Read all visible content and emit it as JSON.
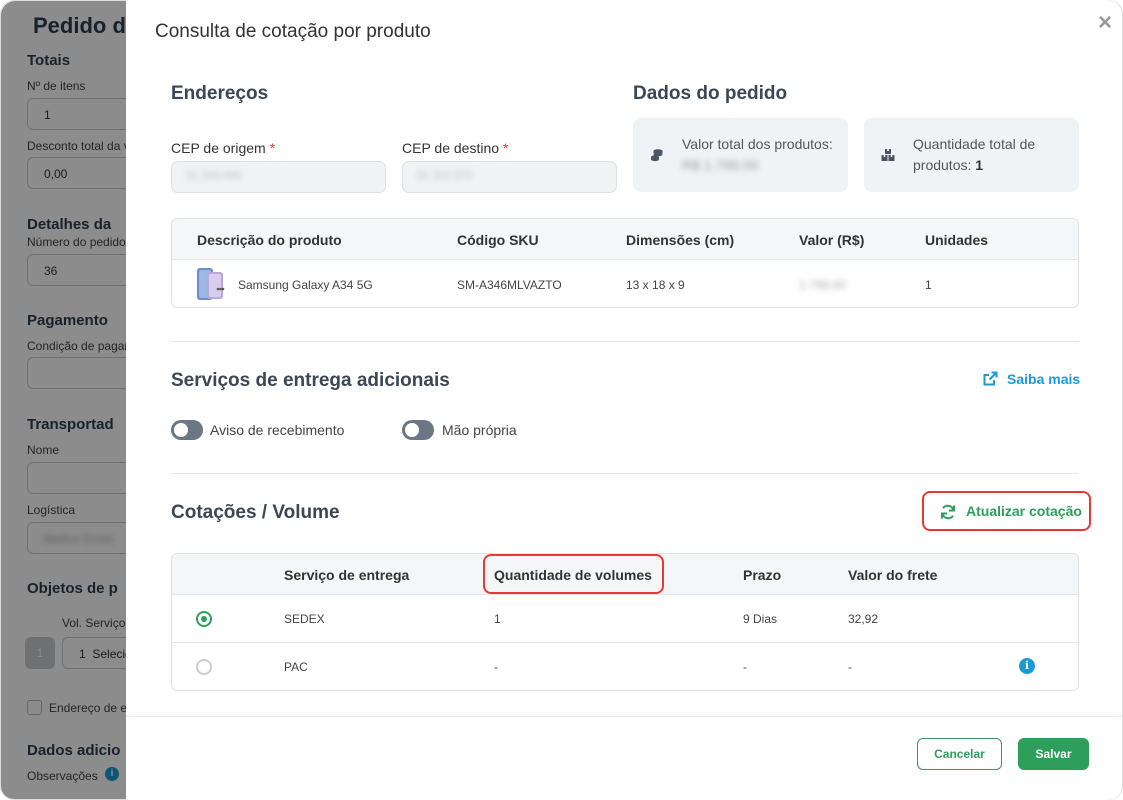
{
  "background": {
    "title": "Pedido d",
    "sections": {
      "totals": "Totais",
      "num_items_label": "Nº de itens",
      "num_items_value": "1",
      "discount_label": "Desconto total da v",
      "discount_value": "0,00",
      "details": "Detalhes da",
      "order_number_label": "Número do pedido",
      "order_number_value": "36",
      "payment": "Pagamento",
      "payment_condition_label": "Condição de pagam",
      "carrier": "Transportad",
      "name_label": "Nome",
      "logistics_label": "Logística",
      "logistics_value": "Melhor Envio",
      "objects": "Objetos de p",
      "vol_service_label": "Vol. Serviço",
      "vol_badge": "1",
      "vol_select_num": "1",
      "vol_select_text": "Selecion",
      "address_checkbox_label": "Endereço de e",
      "additional": "Dados adicio",
      "observations_label": "Observações"
    }
  },
  "modal": {
    "title": "Consulta de cotação por produto",
    "close_icon": "close-icon",
    "addresses": {
      "title": "Endereços",
      "origin_label": "CEP de origem",
      "origin_value": "91 200-000",
      "destination_label": "CEP de destino",
      "destination_value": "91 202-970",
      "required_mark": "*"
    },
    "order_data": {
      "title": "Dados do pedido",
      "total_value_label": "Valor total dos produtos:",
      "total_value": "R$ 1.799,00",
      "total_qty_label": "Quantidade total de produtos:",
      "total_qty": "1"
    },
    "products_table": {
      "headers": [
        "Descrição do produto",
        "Código SKU",
        "Dimensões (cm)",
        "Valor (R$)",
        "Unidades"
      ],
      "rows": [
        {
          "name": "Samsung Galaxy A34 5G",
          "sku": "SM-A346MLVAZTO",
          "dimensions": "13 x 18 x 9",
          "value": "1.799,00",
          "units": "1"
        }
      ]
    },
    "extra_services": {
      "title": "Serviços de entrega adicionais",
      "learn_more": "Saiba mais",
      "toggles": [
        {
          "label": "Aviso de recebimento",
          "on": false
        },
        {
          "label": "Mão própria",
          "on": false
        }
      ]
    },
    "quotes": {
      "title": "Cotações / Volume",
      "refresh_button": "Atualizar cotação",
      "headers": [
        "Serviço de entrega",
        "Quantidade de volumes",
        "Prazo",
        "Valor do frete"
      ],
      "rows": [
        {
          "service": "SEDEX",
          "volumes": "1",
          "deadline": "9 Dias",
          "price": "32,92",
          "selected": true
        },
        {
          "service": "PAC",
          "volumes": "-",
          "deadline": "-",
          "price": "-",
          "selected": false
        }
      ]
    },
    "footer": {
      "cancel": "Cancelar",
      "save": "Salvar"
    }
  },
  "colors": {
    "accent_green": "#2e9e5b",
    "link_blue": "#1a9ad6",
    "highlight_red": "#e53935"
  }
}
